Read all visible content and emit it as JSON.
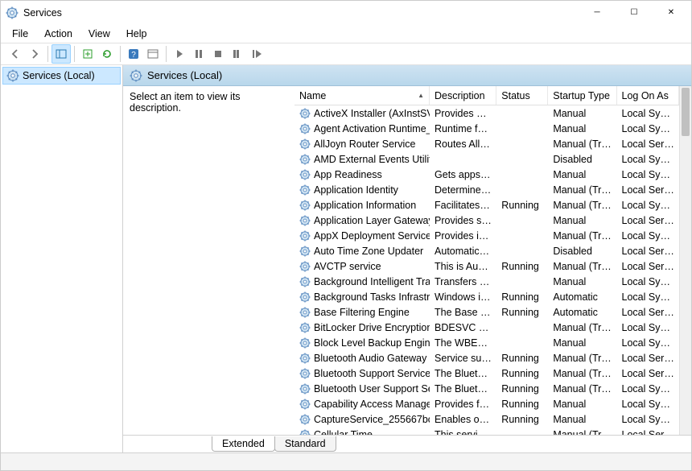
{
  "window": {
    "title": "Services"
  },
  "menu": {
    "file": "File",
    "action": "Action",
    "view": "View",
    "help": "Help"
  },
  "sidebar": {
    "root": "Services (Local)"
  },
  "header": {
    "title": "Services (Local)"
  },
  "description_placeholder": "Select an item to view its description.",
  "columns": {
    "name": "Name",
    "description": "Description",
    "status": "Status",
    "startup": "Startup Type",
    "logon": "Log On As"
  },
  "tabs": {
    "extended": "Extended",
    "standard": "Standard"
  },
  "services": [
    {
      "name": "ActiveX Installer (AxInstSV)",
      "desc": "Provides Us...",
      "status": "",
      "startup": "Manual",
      "logon": "Local Syste..."
    },
    {
      "name": "Agent Activation Runtime_...",
      "desc": "Runtime for...",
      "status": "",
      "startup": "Manual",
      "logon": "Local Syste..."
    },
    {
      "name": "AllJoyn Router Service",
      "desc": "Routes AllJo...",
      "status": "",
      "startup": "Manual (Trig...",
      "logon": "Local Service"
    },
    {
      "name": "AMD External Events Utility",
      "desc": "",
      "status": "",
      "startup": "Disabled",
      "logon": "Local Syste..."
    },
    {
      "name": "App Readiness",
      "desc": "Gets apps re...",
      "status": "",
      "startup": "Manual",
      "logon": "Local Syste..."
    },
    {
      "name": "Application Identity",
      "desc": "Determines ...",
      "status": "",
      "startup": "Manual (Trig...",
      "logon": "Local Service"
    },
    {
      "name": "Application Information",
      "desc": "Facilitates t...",
      "status": "Running",
      "startup": "Manual (Trig...",
      "logon": "Local Syste..."
    },
    {
      "name": "Application Layer Gateway ...",
      "desc": "Provides su...",
      "status": "",
      "startup": "Manual",
      "logon": "Local Service"
    },
    {
      "name": "AppX Deployment Service (...",
      "desc": "Provides inf...",
      "status": "",
      "startup": "Manual (Trig...",
      "logon": "Local Syste..."
    },
    {
      "name": "Auto Time Zone Updater",
      "desc": "Automatica...",
      "status": "",
      "startup": "Disabled",
      "logon": "Local Service"
    },
    {
      "name": "AVCTP service",
      "desc": "This is Audi...",
      "status": "Running",
      "startup": "Manual (Trig...",
      "logon": "Local Service"
    },
    {
      "name": "Background Intelligent Tran...",
      "desc": "Transfers fil...",
      "status": "",
      "startup": "Manual",
      "logon": "Local Syste..."
    },
    {
      "name": "Background Tasks Infrastruc...",
      "desc": "Windows in...",
      "status": "Running",
      "startup": "Automatic",
      "logon": "Local Syste..."
    },
    {
      "name": "Base Filtering Engine",
      "desc": "The Base Fil...",
      "status": "Running",
      "startup": "Automatic",
      "logon": "Local Service"
    },
    {
      "name": "BitLocker Drive Encryption ...",
      "desc": "BDESVC hos...",
      "status": "",
      "startup": "Manual (Trig...",
      "logon": "Local Syste..."
    },
    {
      "name": "Block Level Backup Engine ...",
      "desc": "The WBENG...",
      "status": "",
      "startup": "Manual",
      "logon": "Local Syste..."
    },
    {
      "name": "Bluetooth Audio Gateway S...",
      "desc": "Service sup...",
      "status": "Running",
      "startup": "Manual (Trig...",
      "logon": "Local Service"
    },
    {
      "name": "Bluetooth Support Service",
      "desc": "The Bluetoo...",
      "status": "Running",
      "startup": "Manual (Trig...",
      "logon": "Local Service"
    },
    {
      "name": "Bluetooth User Support Ser...",
      "desc": "The Bluetoo...",
      "status": "Running",
      "startup": "Manual (Trig...",
      "logon": "Local Syste..."
    },
    {
      "name": "Capability Access Manager ...",
      "desc": "Provides fac...",
      "status": "Running",
      "startup": "Manual",
      "logon": "Local Syste..."
    },
    {
      "name": "CaptureService_255667bc",
      "desc": "Enables opti...",
      "status": "Running",
      "startup": "Manual",
      "logon": "Local Syste..."
    },
    {
      "name": "Cellular Time",
      "desc": "This service ...",
      "status": "",
      "startup": "Manual (Trig...",
      "logon": "Local Service"
    }
  ]
}
